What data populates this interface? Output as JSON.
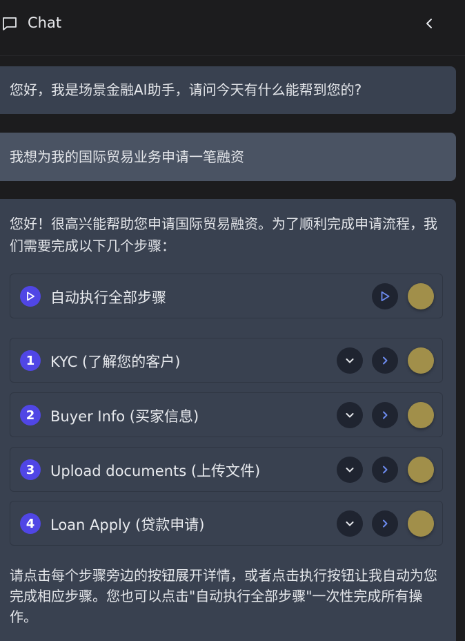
{
  "header": {
    "title": "Chat",
    "icon": "chat-bubble-icon",
    "back_icon": "chevron-left-icon"
  },
  "messages": [
    {
      "role": "assistant",
      "text": "您好，我是场景金融AI助手，请问今天有什么能帮到您的?"
    },
    {
      "role": "user",
      "text": "我想为我的国际贸易业务申请一笔融资"
    }
  ],
  "reply": {
    "intro": "您好！很高兴能帮助您申请国际贸易融资。为了顺利完成申请流程，我们需要完成以下几个步骤：",
    "auto_run": {
      "label": "自动执行全部步骤",
      "icon": "play-icon"
    },
    "steps": [
      {
        "number": "1",
        "label": "KYC (了解您的客户)"
      },
      {
        "number": "2",
        "label": "Buyer Info (买家信息)"
      },
      {
        "number": "3",
        "label": "Upload documents (上传文件)"
      },
      {
        "number": "4",
        "label": "Loan Apply (贷款申请)"
      }
    ],
    "outro": "请点击每个步骤旁边的按钮展开详情，或者点击执行按钮让我自动为您完成相应步骤。您也可以点击\"自动执行全部步骤\"一次性完成所有操作。"
  },
  "colors": {
    "accent": "#5046e5",
    "action_icon": "#6d8cf0",
    "status_dot": "#a18f4a",
    "bubble_assistant": "#394150",
    "bubble_user": "#4a5363"
  }
}
